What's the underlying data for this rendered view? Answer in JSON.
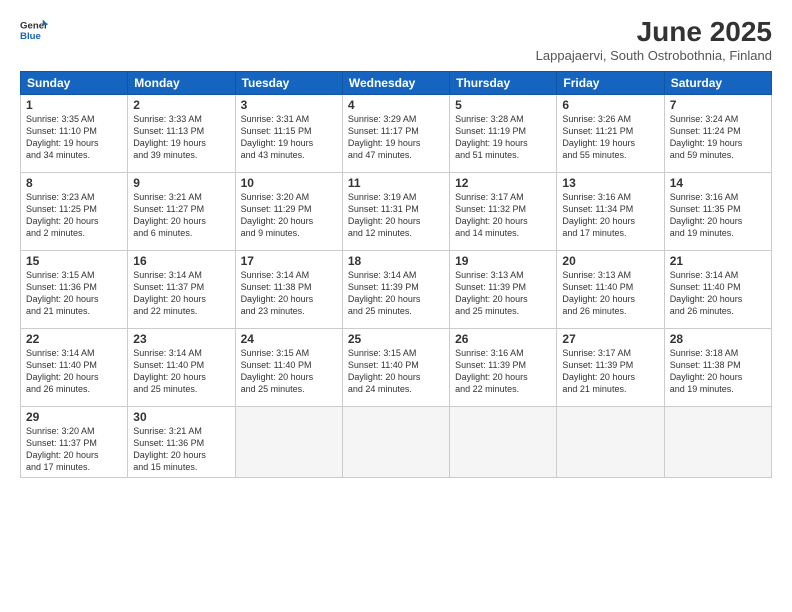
{
  "header": {
    "logo_line1": "General",
    "logo_line2": "Blue",
    "title": "June 2025",
    "subtitle": "Lappajaervi, South Ostrobothnia, Finland"
  },
  "weekdays": [
    "Sunday",
    "Monday",
    "Tuesday",
    "Wednesday",
    "Thursday",
    "Friday",
    "Saturday"
  ],
  "weeks": [
    [
      {
        "day": "1",
        "info": "Sunrise: 3:35 AM\nSunset: 11:10 PM\nDaylight: 19 hours\nand 34 minutes."
      },
      {
        "day": "2",
        "info": "Sunrise: 3:33 AM\nSunset: 11:13 PM\nDaylight: 19 hours\nand 39 minutes."
      },
      {
        "day": "3",
        "info": "Sunrise: 3:31 AM\nSunset: 11:15 PM\nDaylight: 19 hours\nand 43 minutes."
      },
      {
        "day": "4",
        "info": "Sunrise: 3:29 AM\nSunset: 11:17 PM\nDaylight: 19 hours\nand 47 minutes."
      },
      {
        "day": "5",
        "info": "Sunrise: 3:28 AM\nSunset: 11:19 PM\nDaylight: 19 hours\nand 51 minutes."
      },
      {
        "day": "6",
        "info": "Sunrise: 3:26 AM\nSunset: 11:21 PM\nDaylight: 19 hours\nand 55 minutes."
      },
      {
        "day": "7",
        "info": "Sunrise: 3:24 AM\nSunset: 11:24 PM\nDaylight: 19 hours\nand 59 minutes."
      }
    ],
    [
      {
        "day": "8",
        "info": "Sunrise: 3:23 AM\nSunset: 11:25 PM\nDaylight: 20 hours\nand 2 minutes."
      },
      {
        "day": "9",
        "info": "Sunrise: 3:21 AM\nSunset: 11:27 PM\nDaylight: 20 hours\nand 6 minutes."
      },
      {
        "day": "10",
        "info": "Sunrise: 3:20 AM\nSunset: 11:29 PM\nDaylight: 20 hours\nand 9 minutes."
      },
      {
        "day": "11",
        "info": "Sunrise: 3:19 AM\nSunset: 11:31 PM\nDaylight: 20 hours\nand 12 minutes."
      },
      {
        "day": "12",
        "info": "Sunrise: 3:17 AM\nSunset: 11:32 PM\nDaylight: 20 hours\nand 14 minutes."
      },
      {
        "day": "13",
        "info": "Sunrise: 3:16 AM\nSunset: 11:34 PM\nDaylight: 20 hours\nand 17 minutes."
      },
      {
        "day": "14",
        "info": "Sunrise: 3:16 AM\nSunset: 11:35 PM\nDaylight: 20 hours\nand 19 minutes."
      }
    ],
    [
      {
        "day": "15",
        "info": "Sunrise: 3:15 AM\nSunset: 11:36 PM\nDaylight: 20 hours\nand 21 minutes."
      },
      {
        "day": "16",
        "info": "Sunrise: 3:14 AM\nSunset: 11:37 PM\nDaylight: 20 hours\nand 22 minutes."
      },
      {
        "day": "17",
        "info": "Sunrise: 3:14 AM\nSunset: 11:38 PM\nDaylight: 20 hours\nand 23 minutes."
      },
      {
        "day": "18",
        "info": "Sunrise: 3:14 AM\nSunset: 11:39 PM\nDaylight: 20 hours\nand 25 minutes."
      },
      {
        "day": "19",
        "info": "Sunrise: 3:13 AM\nSunset: 11:39 PM\nDaylight: 20 hours\nand 25 minutes."
      },
      {
        "day": "20",
        "info": "Sunrise: 3:13 AM\nSunset: 11:40 PM\nDaylight: 20 hours\nand 26 minutes."
      },
      {
        "day": "21",
        "info": "Sunrise: 3:14 AM\nSunset: 11:40 PM\nDaylight: 20 hours\nand 26 minutes."
      }
    ],
    [
      {
        "day": "22",
        "info": "Sunrise: 3:14 AM\nSunset: 11:40 PM\nDaylight: 20 hours\nand 26 minutes."
      },
      {
        "day": "23",
        "info": "Sunrise: 3:14 AM\nSunset: 11:40 PM\nDaylight: 20 hours\nand 25 minutes."
      },
      {
        "day": "24",
        "info": "Sunrise: 3:15 AM\nSunset: 11:40 PM\nDaylight: 20 hours\nand 25 minutes."
      },
      {
        "day": "25",
        "info": "Sunrise: 3:15 AM\nSunset: 11:40 PM\nDaylight: 20 hours\nand 24 minutes."
      },
      {
        "day": "26",
        "info": "Sunrise: 3:16 AM\nSunset: 11:39 PM\nDaylight: 20 hours\nand 22 minutes."
      },
      {
        "day": "27",
        "info": "Sunrise: 3:17 AM\nSunset: 11:39 PM\nDaylight: 20 hours\nand 21 minutes."
      },
      {
        "day": "28",
        "info": "Sunrise: 3:18 AM\nSunset: 11:38 PM\nDaylight: 20 hours\nand 19 minutes."
      }
    ],
    [
      {
        "day": "29",
        "info": "Sunrise: 3:20 AM\nSunset: 11:37 PM\nDaylight: 20 hours\nand 17 minutes."
      },
      {
        "day": "30",
        "info": "Sunrise: 3:21 AM\nSunset: 11:36 PM\nDaylight: 20 hours\nand 15 minutes."
      },
      {
        "day": "",
        "info": ""
      },
      {
        "day": "",
        "info": ""
      },
      {
        "day": "",
        "info": ""
      },
      {
        "day": "",
        "info": ""
      },
      {
        "day": "",
        "info": ""
      }
    ]
  ]
}
